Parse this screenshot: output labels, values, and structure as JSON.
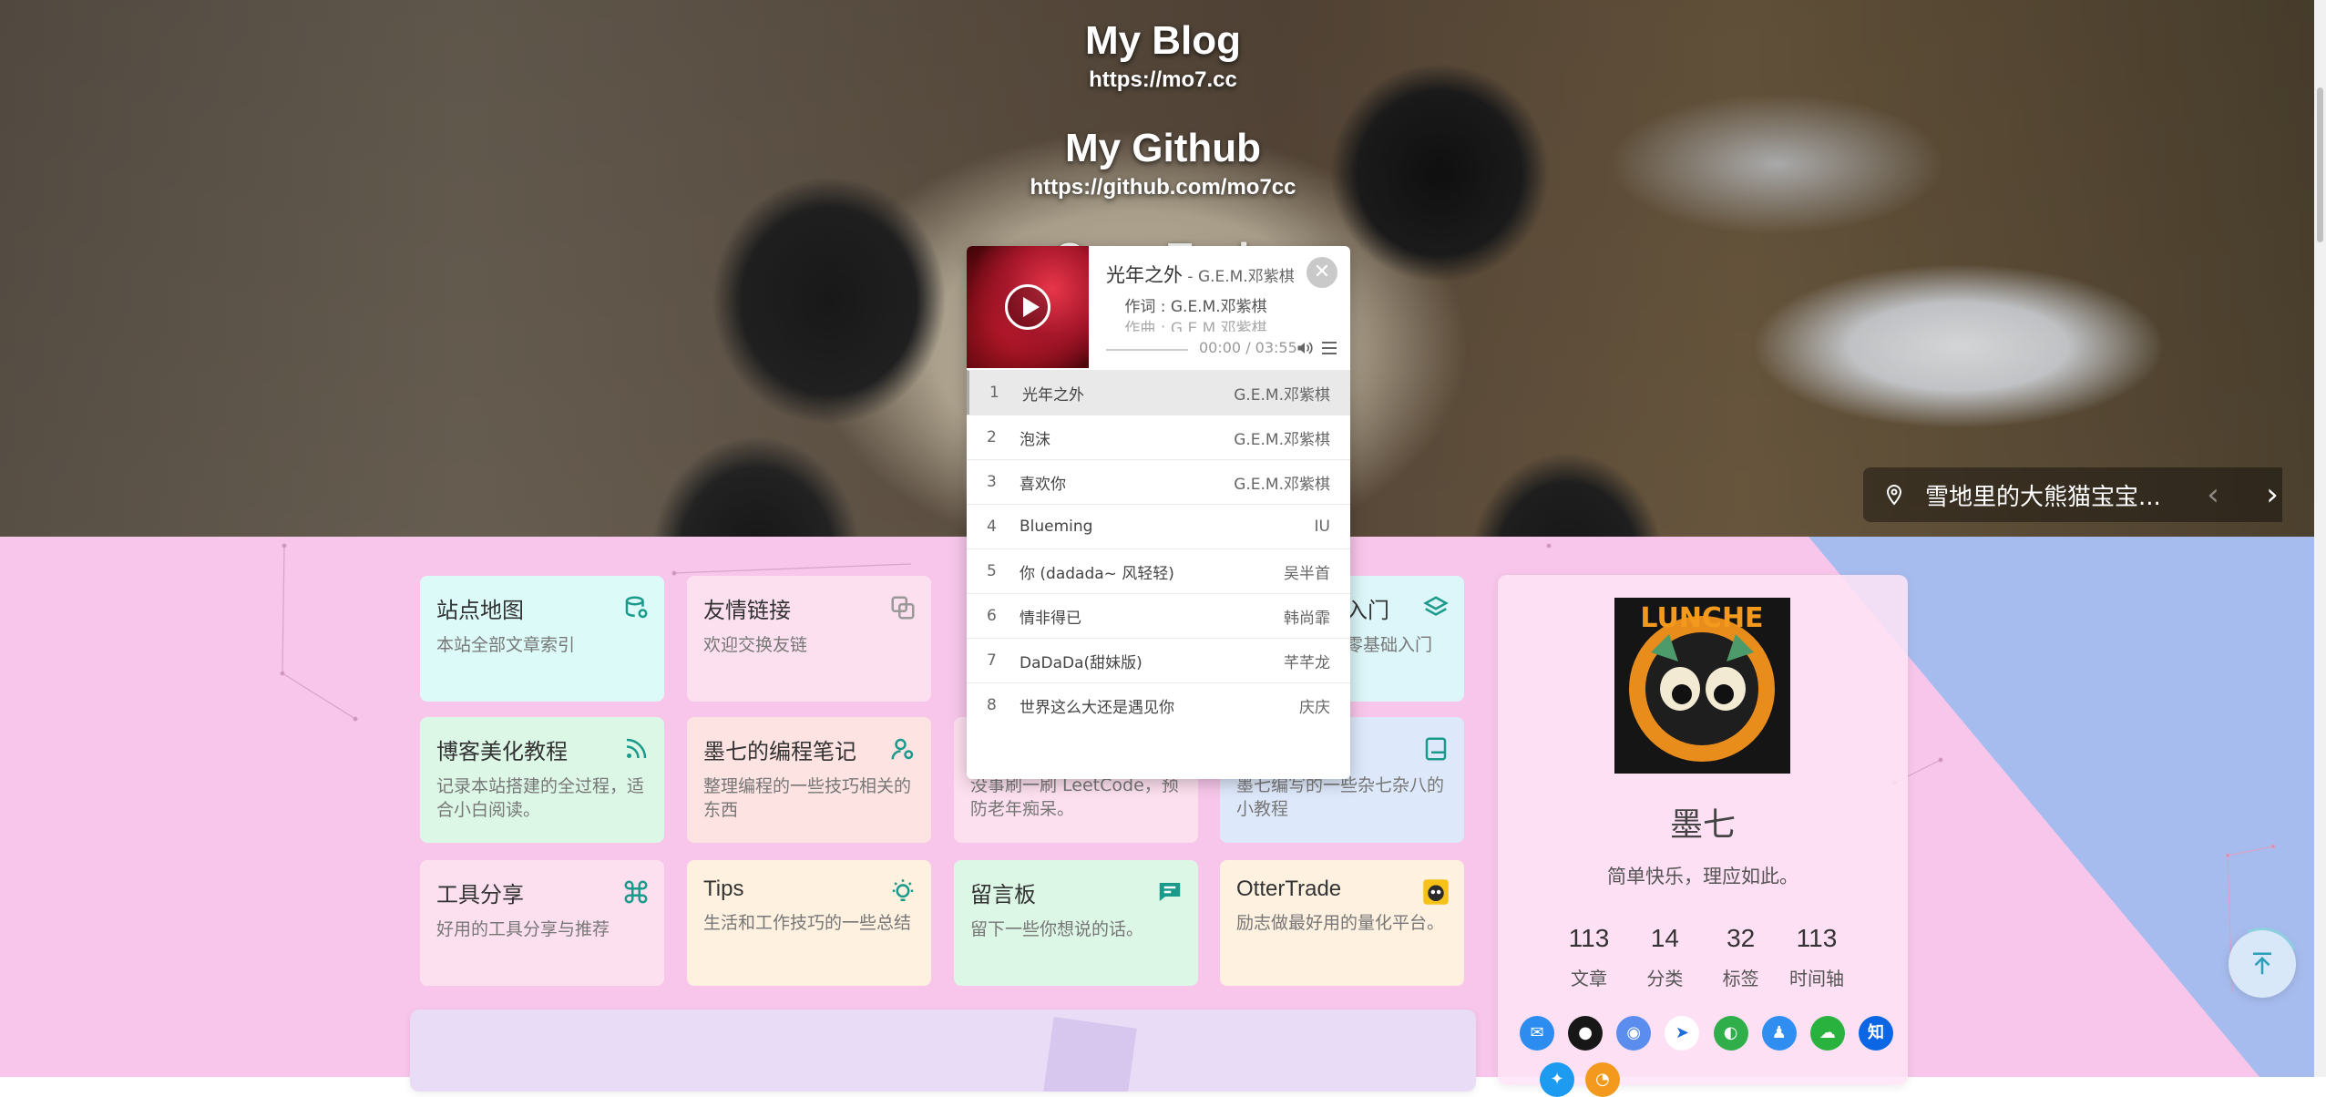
{
  "hero": {
    "title1": "My Blog",
    "url1": "https://mo7.cc",
    "title2": "My Github",
    "url2": "https://github.com/mo7cc",
    "title3": "Open Tools",
    "caption": "雪地里的大熊猫宝宝...",
    "prev_label": "‹",
    "next_label": "›"
  },
  "player": {
    "song": "光年之外",
    "separator": " - ",
    "artist": "G.E.M.邓紫棋",
    "lyric_line1": "作词 : G.E.M.邓紫棋",
    "lyric_line2": "作曲 : G.E.M.邓紫棋",
    "time": "00:00 / 03:55",
    "progress": 0,
    "close_label": "✕",
    "playlist": [
      {
        "index": "1",
        "name": "光年之外",
        "artist": "G.E.M.邓紫棋"
      },
      {
        "index": "2",
        "name": "泡沫",
        "artist": "G.E.M.邓紫棋"
      },
      {
        "index": "3",
        "name": "喜欢你",
        "artist": "G.E.M.邓紫棋"
      },
      {
        "index": "4",
        "name": "Blueming",
        "artist": "IU"
      },
      {
        "index": "5",
        "name": "你 (dadada~ 风轻轻)",
        "artist": "吴半首"
      },
      {
        "index": "6",
        "name": "情非得已",
        "artist": "韩尚霏"
      },
      {
        "index": "7",
        "name": "DaDaDa(甜妹版)",
        "artist": "芊芊龙"
      },
      {
        "index": "8",
        "name": "世界这么大还是遇见你",
        "artist": "庆庆"
      }
    ]
  },
  "cards": {
    "sitemap": {
      "title": "站点地图",
      "desc": "本站全部文章索引",
      "color": "#dcfbf8"
    },
    "friends": {
      "title": "友情链接",
      "desc": "欢迎交换友链",
      "color": "#fde0ef"
    },
    "intro": {
      "title": "入门",
      "desc": "零基础入门",
      "color": "#dcf6f9"
    },
    "beautify": {
      "title": "博客美化教程",
      "desc": "记录本站搭建的全过程，适合小白阅读。",
      "color": "#dcf7e6"
    },
    "notes": {
      "title": "墨七的编程笔记",
      "desc": "整理编程的一些技巧相关的东西",
      "color": "#fde3e2"
    },
    "leetcode": {
      "desc": "没事刷一刷 LeetCode，预防老年痴呆。",
      "color": "#fde0ef"
    },
    "misc": {
      "desc": "墨七编写的一些杂七杂八的小教程",
      "color": "#dde9fb"
    },
    "tools": {
      "title": "工具分享",
      "desc": "好用的工具分享与推荐",
      "color": "#fde0ef"
    },
    "tips": {
      "title": "Tips",
      "desc": "生活和工作技巧的一些总结",
      "color": "#fef1e0"
    },
    "board": {
      "title": "留言板",
      "desc": "留下一些你想说的话。",
      "color": "#dcf7e6"
    },
    "otter": {
      "title": "OtterTrade",
      "desc": "励志做最好用的量化平台。",
      "color": "#fef1e0"
    }
  },
  "profile": {
    "name": "墨七",
    "motto": "简单快乐，理应如此。",
    "stats": [
      {
        "value": "113",
        "label": "文章"
      },
      {
        "value": "14",
        "label": "分类"
      },
      {
        "value": "32",
        "label": "标签"
      },
      {
        "value": "113",
        "label": "时间轴"
      }
    ],
    "zhihu_label": "知",
    "avatar_text": "LUNCHE"
  },
  "colors": {
    "accent": "#1a9a8b",
    "pink_bg": "#f8c6ea",
    "blue_bg": "#a7bcee"
  }
}
